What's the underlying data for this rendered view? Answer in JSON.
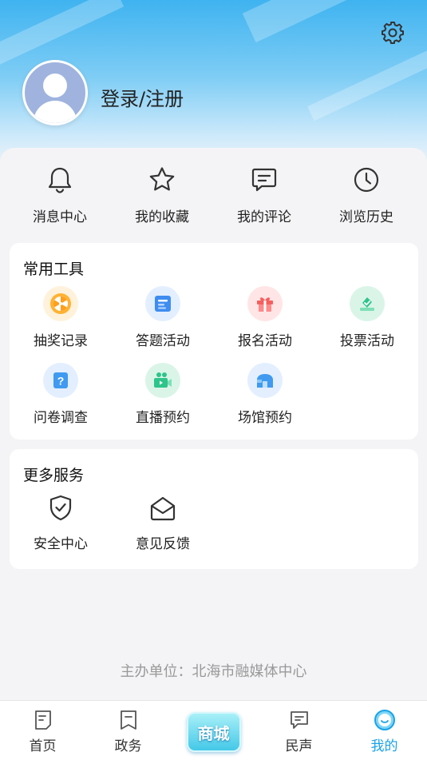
{
  "header": {
    "login_label": "登录/注册",
    "bg_color": "#3fb3f0"
  },
  "quick": [
    {
      "label": "消息中心",
      "icon": "bell-icon"
    },
    {
      "label": "我的收藏",
      "icon": "star-icon"
    },
    {
      "label": "我的评论",
      "icon": "comment-icon"
    },
    {
      "label": "浏览历史",
      "icon": "clock-icon"
    }
  ],
  "tools": {
    "title": "常用工具",
    "items": [
      {
        "label": "抽奖记录",
        "icon": "lottery-wheel-icon",
        "color": "#ff9f1a"
      },
      {
        "label": "答题活动",
        "icon": "quiz-card-icon",
        "color": "#3f8df0"
      },
      {
        "label": "报名活动",
        "icon": "gift-icon",
        "color": "#f5605f"
      },
      {
        "label": "投票活动",
        "icon": "vote-icon",
        "color": "#2ec48a"
      },
      {
        "label": "问卷调查",
        "icon": "question-icon",
        "color": "#3f9af0"
      },
      {
        "label": "直播预约",
        "icon": "video-camera-icon",
        "color": "#2ec48a"
      },
      {
        "label": "场馆预约",
        "icon": "venue-icon",
        "color": "#3f9af0"
      }
    ]
  },
  "services": {
    "title": "更多服务",
    "items": [
      {
        "label": "安全中心",
        "icon": "shield-check-icon"
      },
      {
        "label": "意见反馈",
        "icon": "open-mail-icon"
      }
    ]
  },
  "footer_note": "主办单位：北海市融媒体中心",
  "tabs": [
    {
      "label": "首页",
      "icon": "home-doc-icon"
    },
    {
      "label": "政务",
      "icon": "bookmark-icon"
    },
    {
      "label": "商城",
      "icon": "mall-badge"
    },
    {
      "label": "民声",
      "icon": "chat-icon"
    },
    {
      "label": "我的",
      "icon": "smile-icon",
      "active": true
    }
  ],
  "colors": {
    "accent": "#1aa3e8",
    "page_bg": "#f4f4f6"
  }
}
